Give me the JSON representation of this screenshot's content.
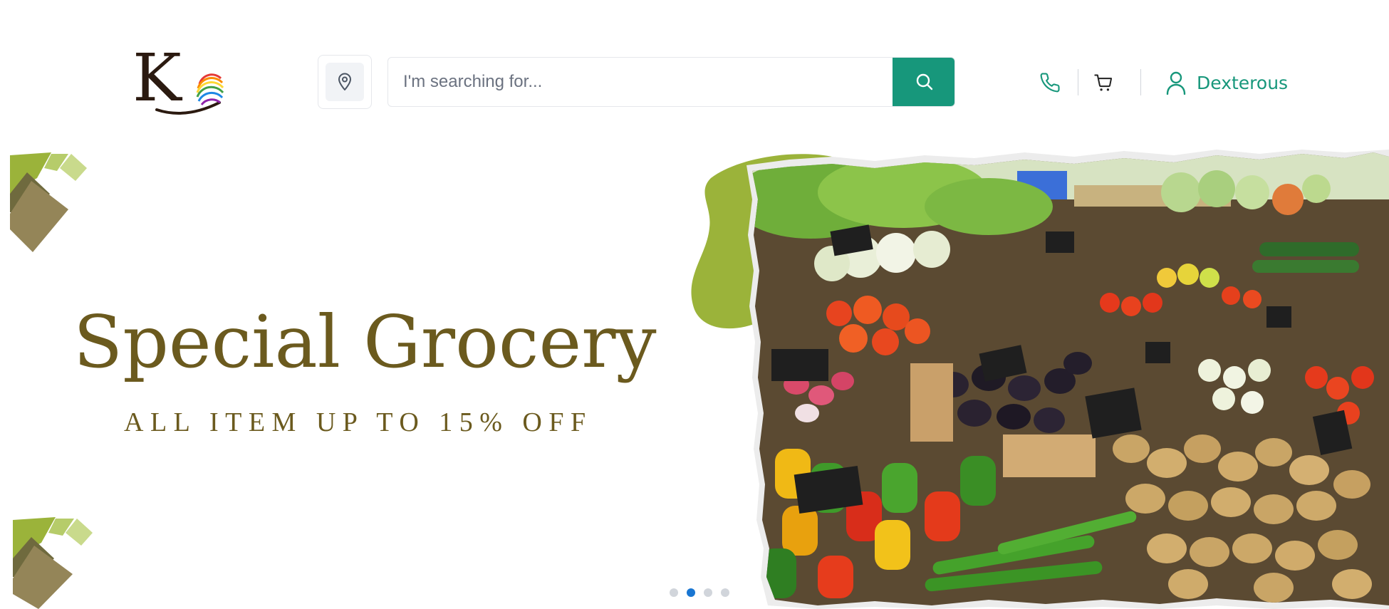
{
  "header": {
    "logo_letter": "K",
    "search": {
      "placeholder": "I'm searching for...",
      "value": ""
    },
    "account": {
      "name": "Dexterous"
    },
    "icons": {
      "location": "map-pin-icon",
      "search": "search-icon",
      "phone": "phone-icon",
      "cart": "cart-icon",
      "user": "user-icon"
    }
  },
  "hero": {
    "title": "Special Grocery",
    "subtitle": "ALL ITEM UP TO 15% OFF",
    "image": "vegetable-market-photo"
  },
  "carousel": {
    "slide_count": 4,
    "active_index": 1
  },
  "colors": {
    "brand_green": "#17977b",
    "hero_text": "#6b5a1e",
    "leaf_green": "#9bb33a",
    "deco_brown": "#948558",
    "active_dot": "#1976d2",
    "inactive_dot": "#d1d5db"
  }
}
